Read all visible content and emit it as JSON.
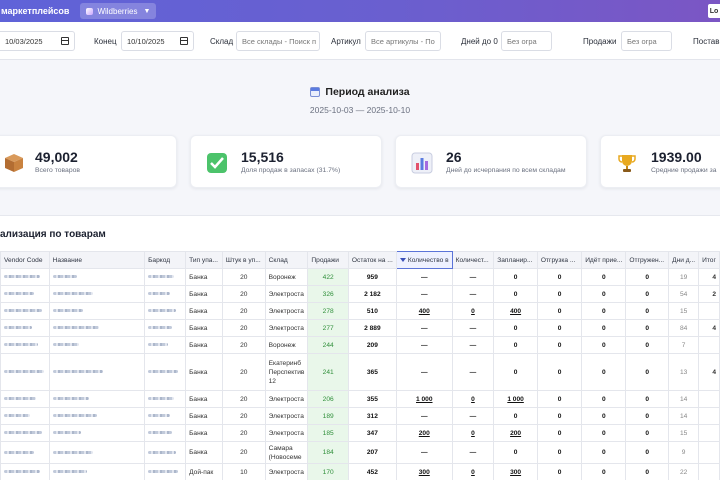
{
  "header": {
    "brand": "маркетплейсов",
    "marketplace": "Wildberries",
    "marketplace_caret": "▼",
    "right_button": "Lo"
  },
  "filters": {
    "start_value": "10/03/2025",
    "end_label": "Конец",
    "end_value": "10/10/2025",
    "warehouse_label": "Склад",
    "warehouse_placeholder": "Все склады - Поиск п",
    "article_label": "Артикул",
    "article_placeholder": "Все артикулы - По",
    "days_label": "Дней до 0",
    "days_placeholder": "Без огра",
    "sales_label": "Продажи",
    "sales_placeholder": "Без огра",
    "supply_label": "Постав"
  },
  "period": {
    "title": "Период анализа",
    "dates": "2025-10-03 — 2025-10-10"
  },
  "stats": [
    {
      "value": "49,002",
      "label": "Всего товаров",
      "icon": "box-icon"
    },
    {
      "value": "15,516",
      "label": "Доля продаж в запасах (31.7%)",
      "icon": "check-icon"
    },
    {
      "value": "26",
      "label": "Дней до исчерпания по всем складам",
      "icon": "chart-icon"
    },
    {
      "value": "1939.00",
      "label": "Средние продажи за",
      "icon": "trophy-icon"
    }
  ],
  "section": {
    "title": "ализация по товарам"
  },
  "table": {
    "columns": [
      "Vendor Code",
      "Название",
      "Баркод",
      "Тип упа...",
      "Штук в уп...",
      "Склад",
      "Продажи",
      "Остаток на ...",
      "Количество в",
      "Количест...",
      "Запланир...",
      "Отгрузка ...",
      "Идёт прие...",
      "Отгружен...",
      "Дни д...",
      "Итог"
    ],
    "rows": [
      {
        "pack": "Банка",
        "pcs": "20",
        "wh": "Воронеж",
        "sales": "422",
        "stock": "959",
        "qty": "—",
        "qty2": "—",
        "plan": "0",
        "ship": "0",
        "recv": "0",
        "shipped": "0",
        "days": "19",
        "total": "4"
      },
      {
        "pack": "Банка",
        "pcs": "20",
        "wh": "Электроста",
        "sales": "326",
        "stock": "2 182",
        "qty": "—",
        "qty2": "—",
        "plan": "0",
        "ship": "0",
        "recv": "0",
        "shipped": "0",
        "days": "54",
        "total": "2"
      },
      {
        "pack": "Банка",
        "pcs": "20",
        "wh": "Электроста",
        "sales": "278",
        "stock": "510",
        "qty": "400",
        "qty2": "0",
        "plan": "400",
        "ship": "0",
        "recv": "0",
        "shipped": "0",
        "days": "15",
        "total": ""
      },
      {
        "pack": "Банка",
        "pcs": "20",
        "wh": "Электроста",
        "sales": "277",
        "stock": "2 889",
        "qty": "—",
        "qty2": "—",
        "plan": "0",
        "ship": "0",
        "recv": "0",
        "shipped": "0",
        "days": "84",
        "total": "4"
      },
      {
        "pack": "Банка",
        "pcs": "20",
        "wh": "Воронеж",
        "sales": "244",
        "stock": "209",
        "qty": "—",
        "qty2": "—",
        "plan": "0",
        "ship": "0",
        "recv": "0",
        "shipped": "0",
        "days": "7",
        "total": ""
      },
      {
        "pack": "Банка",
        "pcs": "20",
        "wh": "Екатеринб Перспектив 12",
        "sales": "241",
        "stock": "365",
        "qty": "—",
        "qty2": "—",
        "plan": "0",
        "ship": "0",
        "recv": "0",
        "shipped": "0",
        "days": "13",
        "total": "4"
      },
      {
        "pack": "Банка",
        "pcs": "20",
        "wh": "Электроста",
        "sales": "206",
        "stock": "355",
        "qty": "1 000",
        "qty2": "0",
        "plan": "1 000",
        "ship": "0",
        "recv": "0",
        "shipped": "0",
        "days": "14",
        "total": ""
      },
      {
        "pack": "Банка",
        "pcs": "20",
        "wh": "Электроста",
        "sales": "189",
        "stock": "312",
        "qty": "—",
        "qty2": "—",
        "plan": "0",
        "ship": "0",
        "recv": "0",
        "shipped": "0",
        "days": "14",
        "total": ""
      },
      {
        "pack": "Банка",
        "pcs": "20",
        "wh": "Электроста",
        "sales": "185",
        "stock": "347",
        "qty": "200",
        "qty2": "0",
        "plan": "200",
        "ship": "0",
        "recv": "0",
        "shipped": "0",
        "days": "15",
        "total": ""
      },
      {
        "pack": "Банка",
        "pcs": "20",
        "wh": "Самара (Новосеме",
        "sales": "184",
        "stock": "207",
        "qty": "—",
        "qty2": "—",
        "plan": "0",
        "ship": "0",
        "recv": "0",
        "shipped": "0",
        "days": "9",
        "total": ""
      },
      {
        "pack": "Дой-пак",
        "pcs": "10",
        "wh": "Электроста",
        "sales": "170",
        "stock": "452",
        "qty": "300",
        "qty2": "0",
        "plan": "300",
        "ship": "0",
        "recv": "0",
        "shipped": "0",
        "days": "22",
        "total": ""
      }
    ]
  },
  "colors": {
    "header_gradient_start": "#5f63d8",
    "header_gradient_end": "#7b56c4",
    "sales_bg": "#e9f7ea",
    "sales_text": "#2f8f3a",
    "active_header_border": "#5b74d8"
  }
}
